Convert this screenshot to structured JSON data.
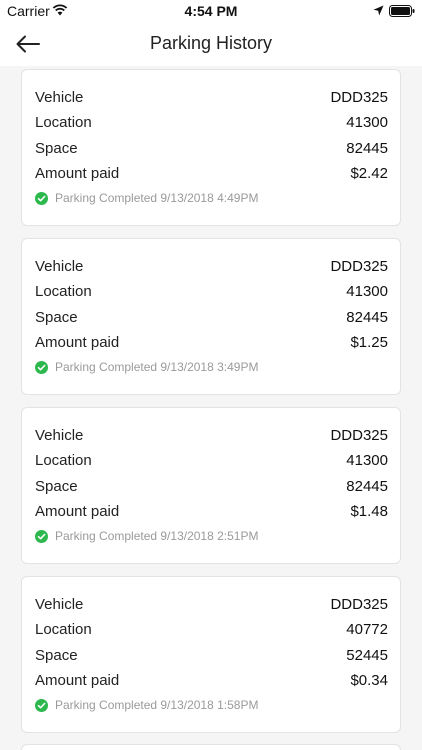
{
  "status_bar": {
    "carrier": "Carrier",
    "time": "4:54 PM"
  },
  "nav": {
    "title": "Parking History",
    "back_icon": "arrow-left-icon"
  },
  "labels": {
    "vehicle": "Vehicle",
    "location": "Location",
    "space": "Space",
    "amount": "Amount paid"
  },
  "colors": {
    "success": "#2db84d",
    "muted": "#9a9a9a"
  },
  "records": [
    {
      "vehicle": "DDD325",
      "location": "41300",
      "space": "82445",
      "amount": "$2.42",
      "status": "Parking Completed 9/13/2018 4:49PM"
    },
    {
      "vehicle": "DDD325",
      "location": "41300",
      "space": "82445",
      "amount": "$1.25",
      "status": "Parking Completed 9/13/2018 3:49PM"
    },
    {
      "vehicle": "DDD325",
      "location": "41300",
      "space": "82445",
      "amount": "$1.48",
      "status": "Parking Completed 9/13/2018 2:51PM"
    },
    {
      "vehicle": "DDD325",
      "location": "40772",
      "space": "52445",
      "amount": "$0.34",
      "status": "Parking Completed 9/13/2018 1:58PM"
    }
  ]
}
